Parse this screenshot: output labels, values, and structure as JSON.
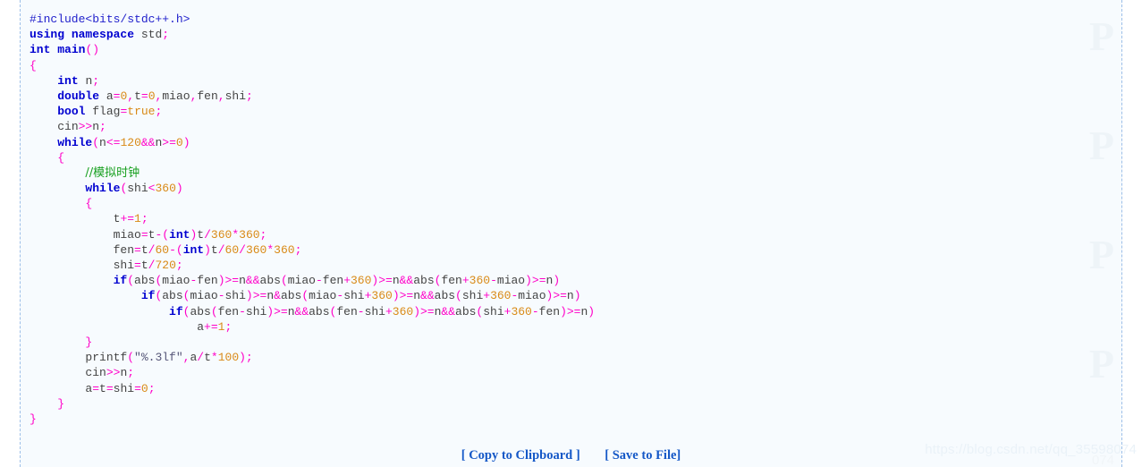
{
  "code_block": {
    "language": "cpp",
    "lines": [
      {
        "id": "l1",
        "text": "#include<bits/stdc++.h>"
      },
      {
        "id": "l2",
        "text": "using namespace std;"
      },
      {
        "id": "l3",
        "text": "int main()"
      },
      {
        "id": "l4",
        "text": "{"
      },
      {
        "id": "l5",
        "text": "    int n;"
      },
      {
        "id": "l6",
        "text": "    double a=0,t=0,miao,fen,shi;"
      },
      {
        "id": "l7",
        "text": "    bool flag=true;"
      },
      {
        "id": "l8",
        "text": "    cin>>n;"
      },
      {
        "id": "l9",
        "text": "    while(n<=120&&n>=0)"
      },
      {
        "id": "l10",
        "text": "    {"
      },
      {
        "id": "l11",
        "text": "        //模拟时钟"
      },
      {
        "id": "l12",
        "text": "        while(shi<360)"
      },
      {
        "id": "l13",
        "text": "        {"
      },
      {
        "id": "l14",
        "text": "            t+=1;"
      },
      {
        "id": "l15",
        "text": "            miao=t-(int)t/360*360;"
      },
      {
        "id": "l16",
        "text": "            fen=t/60-(int)t/60/360*360;"
      },
      {
        "id": "l17",
        "text": "            shi=t/720;"
      },
      {
        "id": "l18",
        "text": "            if(abs(miao-fen)>=n&&abs(miao-fen+360)>=n&&abs(fen+360-miao)>=n)"
      },
      {
        "id": "l19",
        "text": "                if(abs(miao-shi)>=n&abs(miao-shi+360)>=n&&abs(shi+360-miao)>=n)"
      },
      {
        "id": "l20",
        "text": "                    if(abs(fen-shi)>=n&&abs(fen-shi+360)>=n&&abs(shi+360-fen)>=n)"
      },
      {
        "id": "l21",
        "text": "                        a+=1;"
      },
      {
        "id": "l22",
        "text": "        }"
      },
      {
        "id": "l23",
        "text": "        printf(\"%.3lf\",a/t*100);"
      },
      {
        "id": "l24",
        "text": "        cin>>n;"
      },
      {
        "id": "l25",
        "text": "        a=t=shi=0;"
      },
      {
        "id": "l26",
        "text": "    }"
      },
      {
        "id": "l27",
        "text": "}"
      }
    ],
    "comment_text": "//模拟时钟"
  },
  "footer": {
    "copy_label": "[ Copy to Clipboard ]",
    "save_label": "[ Save to File]"
  },
  "watermark": {
    "url": "https://blog.csdn.net/qq_35598074",
    "mark_letter": "P",
    "bottom_fragment": "074"
  },
  "colors": {
    "panel_background": "#f7fbfe",
    "border": "#9dbfe8",
    "keyword": "#0000d0",
    "preprocessor": "#2222cc",
    "punctuation": "#ff00c8",
    "number": "#d98a17",
    "identifier": "#444444",
    "string": "#555577",
    "comment": "#18a020",
    "link": "#1558c7",
    "watermark": "#eaf2f8"
  }
}
